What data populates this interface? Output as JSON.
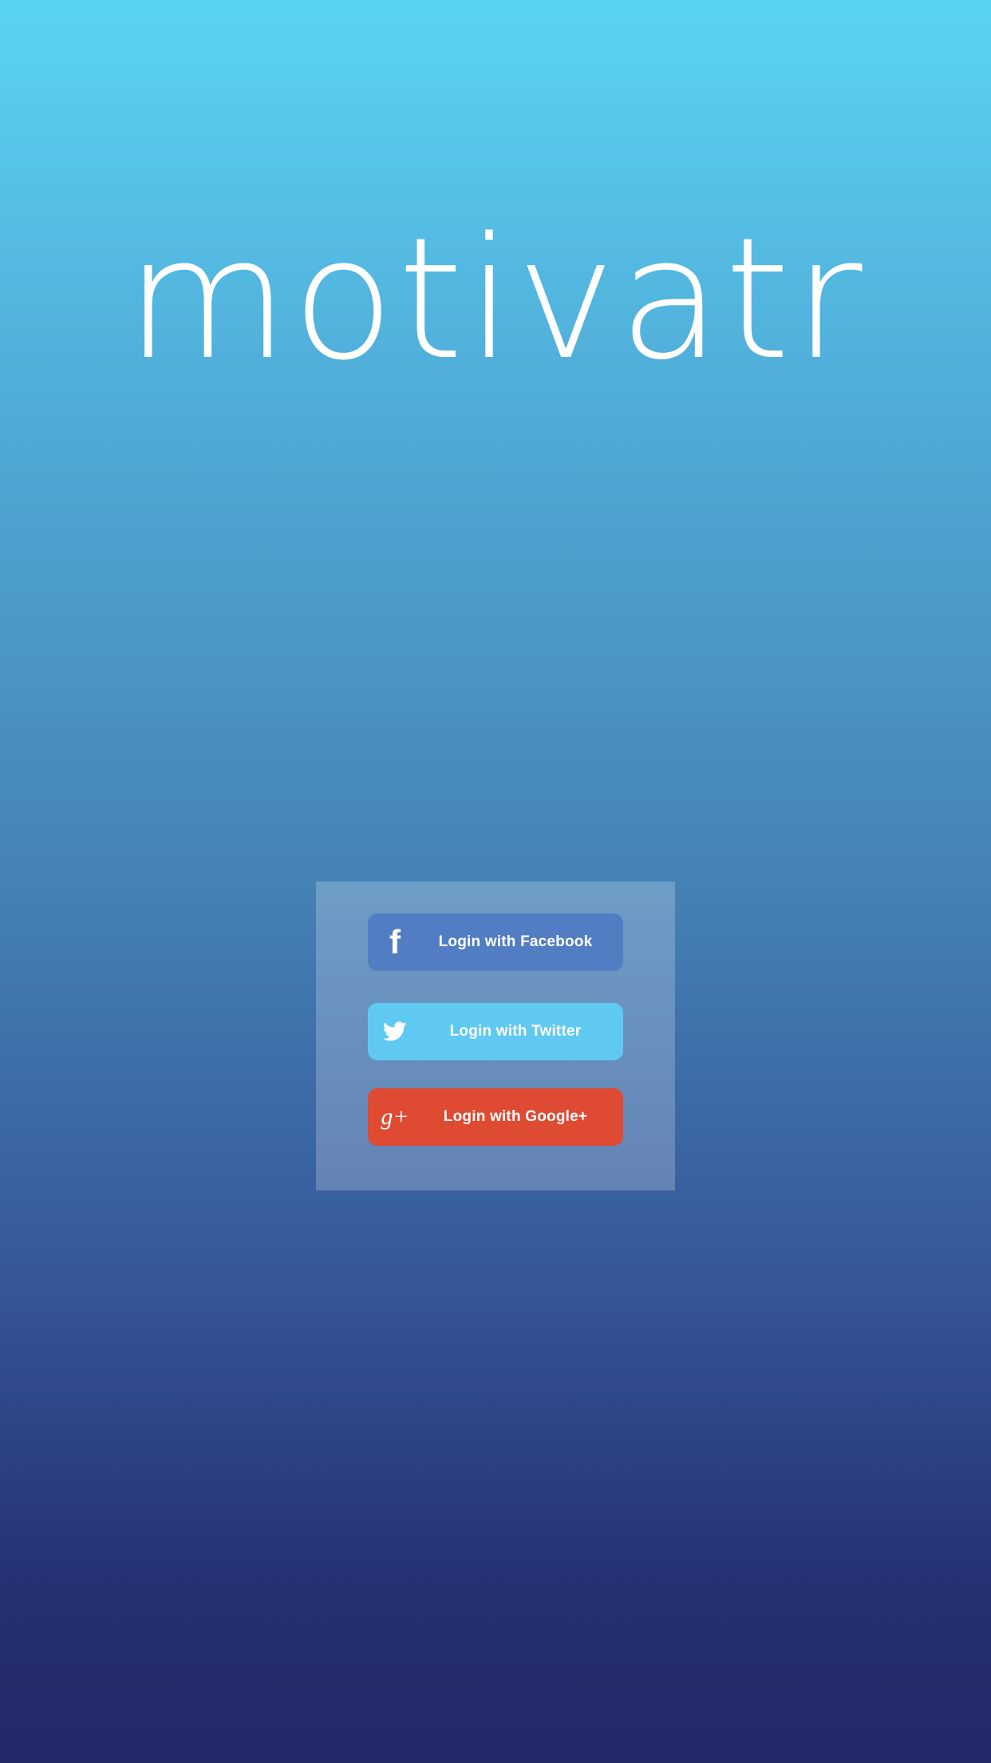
{
  "app": {
    "title": "motivatr"
  },
  "login": {
    "buttons": [
      {
        "label": "Login with Facebook",
        "icon": "facebook-icon",
        "color": "#527dc2"
      },
      {
        "label": "Login with Twitter",
        "icon": "twitter-icon",
        "color": "#60c9f1"
      },
      {
        "label": "Login with Google+",
        "icon": "google-plus-icon",
        "color": "#df4a32"
      }
    ]
  },
  "theme": {
    "background_top": "#5ad3f4",
    "background_bottom": "#232867",
    "panel_overlay": "rgba(255,255,255,0.22)"
  }
}
